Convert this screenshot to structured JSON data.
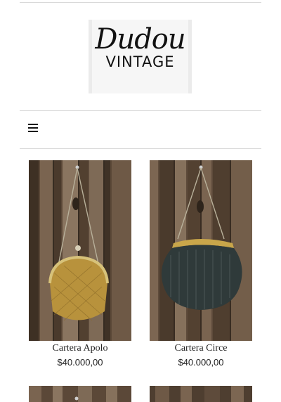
{
  "header": {
    "logo_script": "Dudou",
    "logo_sub": "VINTAGE",
    "menu_icon": "hamburger-menu-icon"
  },
  "products": [
    {
      "name": "Cartera Apolo",
      "price": "$40.000,00",
      "image": "gold-beaded-purse-photo"
    },
    {
      "name": "Cartera Circe",
      "price": "$40.000,00",
      "image": "dark-beaded-purse-photo"
    }
  ],
  "colors": {
    "wood_dark": "#4a3a2c",
    "wood_light": "#8a7560",
    "gold_bag": "#b8923c",
    "dark_bag": "#2f3a3a",
    "divider": "#d9d9d9"
  }
}
